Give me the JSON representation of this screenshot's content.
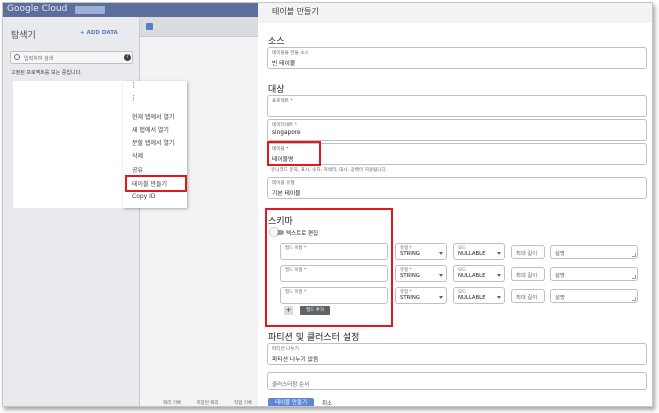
{
  "console": {
    "brand": "Google Cloud",
    "explorer_title": "탐색기",
    "add_data": "+ ADD DATA",
    "search_placeholder": "입력하여 검색",
    "help_icon": "?",
    "starred_text": "고정된 프로젝트를 보는 중입니다.",
    "bottom_tabs": [
      "쿼리 기록",
      "저장된 쿼리",
      "작업 기록"
    ]
  },
  "context_menu": {
    "items": [
      "현재 탭에서 열기",
      "새 탭에서 열기",
      "분할 탭에서 열기",
      "삭제",
      "공유",
      "테이블 만들기",
      "Copy ID"
    ]
  },
  "panel": {
    "title": "테이블 만들기",
    "source": {
      "heading": "소스",
      "create_from_label": "테이블을 만들 소스",
      "create_from_value": "빈 테이블"
    },
    "destination": {
      "heading": "대상",
      "project_label": "프로젝트 *",
      "project_value": "",
      "dataset_label": "데이터세트 *",
      "dataset_value": "singapore",
      "table_label": "테이블 *",
      "table_value": "테이블명",
      "table_hint": "유니코드 문자, 표시, 숫자, 커넥터, 대시, 공백이 허용됩니다.",
      "table_type_label": "테이블 유형",
      "table_type_value": "기본 테이블"
    },
    "schema": {
      "heading": "스키마",
      "text_edit_label": "텍스트로 편집",
      "field_name_label": "필드 이름 *",
      "type_label": "유형 *",
      "type_value": "STRING",
      "mode_label": "모드",
      "mode_value": "NULLABLE",
      "max_length_label": "최대 길이",
      "description_label": "설명",
      "rows": [
        {
          "field_name": ""
        },
        {
          "field_name": ""
        },
        {
          "field_name": ""
        }
      ],
      "add_field": "필드 추가",
      "add_icon": "+"
    },
    "partition": {
      "heading": "파티션 및 클러스터 설정",
      "partition_label": "파티션 나누기",
      "partition_value": "파티션 나누기 없음",
      "cluster_placeholder": "클러스터링 순서"
    },
    "actions": {
      "create": "테이블 만들기",
      "cancel": "취소"
    }
  }
}
